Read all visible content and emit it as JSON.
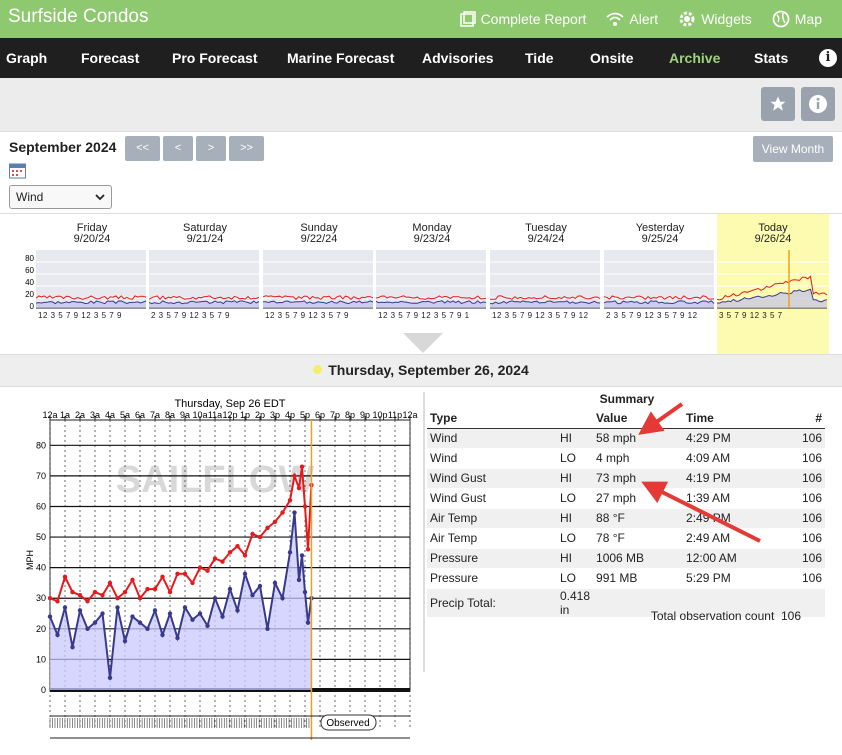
{
  "header": {
    "title": "Surfside Condos",
    "links": [
      {
        "label": "Complete Report",
        "icon": "report-icon"
      },
      {
        "label": "Alert",
        "icon": "wifi-icon"
      },
      {
        "label": "Widgets",
        "icon": "gear-icon"
      },
      {
        "label": "Map",
        "icon": "globe-icon"
      }
    ]
  },
  "nav": {
    "items": [
      "Graph",
      "Forecast",
      "Pro Forecast",
      "Marine Forecast",
      "Advisories",
      "Tide",
      "Onsite",
      "Archive",
      "Stats"
    ],
    "active": "Archive",
    "info": "i"
  },
  "toolbar": {
    "star_icon": "star-icon",
    "info_icon": "info-icon"
  },
  "calendar": {
    "month": "September 2024",
    "first": "<<",
    "prev": "<",
    "next": ">",
    "last": ">>",
    "view_month": "View Month",
    "select_value": "Wind"
  },
  "week": [
    {
      "day": "Friday",
      "date": "9/20/24",
      "ticks": "12 3 5 7 9 12 3 5 7 9"
    },
    {
      "day": "Saturday",
      "date": "9/21/24",
      "ticks": "2 3 5 7 9 12 3 5 7 9"
    },
    {
      "day": "Sunday",
      "date": "9/22/24",
      "ticks": "12 3 5 7 9 12 3 5 7 9"
    },
    {
      "day": "Monday",
      "date": "9/23/24",
      "ticks": "12 3 5 7 9 12 3 5 7 9 1"
    },
    {
      "day": "Tuesday",
      "date": "9/24/24",
      "ticks": "12 3 5 7 9 12 3 5 7 9 12"
    },
    {
      "day": "Yesterday",
      "date": "9/25/24",
      "ticks": "2 3 5 7 9 12 3 5 7 9 12"
    },
    {
      "day": "Today",
      "date": "9/26/24",
      "ticks": "3 5 7 9 12 3 5 7"
    }
  ],
  "week_yticks": [
    "80",
    "60",
    "40",
    "20",
    "0"
  ],
  "selected_date": "Thursday, September 26, 2024",
  "chart": {
    "title": "Thursday, Sep 26 EDT",
    "watermark": "SAILFLOW",
    "ylabel": "MPH",
    "observed": "Observed"
  },
  "chart_data": {
    "type": "line",
    "title": "Thursday, Sep 26 EDT",
    "ylabel": "MPH",
    "xlabel": "",
    "x_ticks": [
      "12a",
      "1a",
      "2a",
      "3a",
      "4a",
      "5a",
      "6a",
      "7a",
      "8a",
      "9a",
      "10a",
      "11a",
      "12p",
      "1p",
      "2p",
      "3p",
      "4p",
      "5p",
      "6p",
      "7p",
      "8p",
      "9p",
      "10p",
      "11p",
      "12a"
    ],
    "y_ticks": [
      0,
      10,
      20,
      30,
      40,
      50,
      60,
      70,
      80
    ],
    "ylim": [
      0,
      85
    ],
    "current_time_hour": 17.43,
    "series": [
      {
        "color": "#e8191c",
        "x": [
          0,
          0.5,
          1,
          1.5,
          2,
          2.5,
          3,
          3.5,
          4,
          4.5,
          5,
          5.5,
          6,
          6.5,
          7,
          7.5,
          8,
          8.5,
          9,
          9.5,
          10,
          10.5,
          11,
          11.5,
          12,
          12.5,
          13,
          13.5,
          14,
          14.5,
          15,
          15.5,
          16,
          16.3,
          16.6,
          16.8,
          17,
          17.2,
          17.43
        ],
        "values": [
          30,
          29,
          37,
          32,
          31,
          29,
          32,
          31,
          35,
          30,
          32,
          36,
          30,
          33,
          33,
          37,
          32,
          38,
          38,
          35,
          40,
          39,
          43,
          42,
          45,
          47,
          44,
          51,
          50,
          53,
          55,
          58,
          62,
          70,
          66,
          73,
          60,
          46,
          67
        ]
      },
      {
        "color": "#3a3a8c",
        "x": [
          0,
          0.5,
          1,
          1.5,
          2,
          2.5,
          3,
          3.5,
          4,
          4.5,
          5,
          5.5,
          6,
          6.5,
          7,
          7.5,
          8,
          8.5,
          9,
          9.5,
          10,
          10.5,
          11,
          11.5,
          12,
          12.5,
          13,
          13.5,
          14,
          14.5,
          15,
          15.5,
          16,
          16.3,
          16.6,
          16.8,
          17,
          17.2,
          17.43
        ],
        "values": [
          24,
          18,
          27,
          14,
          26,
          20,
          22,
          25,
          4,
          27,
          16,
          24,
          22,
          20,
          26,
          18,
          25,
          17,
          27,
          23,
          25,
          21,
          30,
          24,
          33,
          26,
          38,
          31,
          34,
          20,
          35,
          30,
          45,
          58,
          36,
          44,
          32,
          22,
          30
        ]
      }
    ]
  },
  "summary": {
    "title": "Summary",
    "headers": [
      "Type",
      "",
      "Value",
      "Time",
      "#"
    ],
    "rows": [
      {
        "type": "Wind",
        "hl": "HI",
        "value": "58 mph",
        "time": "4:29 PM",
        "n": "106"
      },
      {
        "type": "Wind",
        "hl": "LO",
        "value": "4 mph",
        "time": "4:09 AM",
        "n": "106"
      },
      {
        "type": "Wind Gust",
        "hl": "HI",
        "value": "73 mph",
        "time": "4:19 PM",
        "n": "106"
      },
      {
        "type": "Wind Gust",
        "hl": "LO",
        "value": "27 mph",
        "time": "1:39 AM",
        "n": "106"
      },
      {
        "type": "Air Temp",
        "hl": "HI",
        "value": "88 °F",
        "time": "2:49 PM",
        "n": "106"
      },
      {
        "type": "Air Temp",
        "hl": "LO",
        "value": "78 °F",
        "time": "2:49 AM",
        "n": "106"
      },
      {
        "type": "Pressure",
        "hl": "HI",
        "value": "1006 MB",
        "time": "12:00 AM",
        "n": "106"
      },
      {
        "type": "Pressure",
        "hl": "LO",
        "value": "991 MB",
        "time": "5:29 PM",
        "n": "106"
      },
      {
        "type": "Precip Total:",
        "hl": "0.418 in",
        "value": "",
        "time": "",
        "n": ""
      }
    ],
    "total_label": "Total observation count",
    "total_value": "106"
  },
  "colors": {
    "topbar": "#8ec86f",
    "nav": "#1f1f1f",
    "active": "#9fd27c",
    "gust": "#e8191c",
    "wind": "#3a3a8c",
    "today": "#fdfbb0",
    "arrow": "#e53935"
  }
}
